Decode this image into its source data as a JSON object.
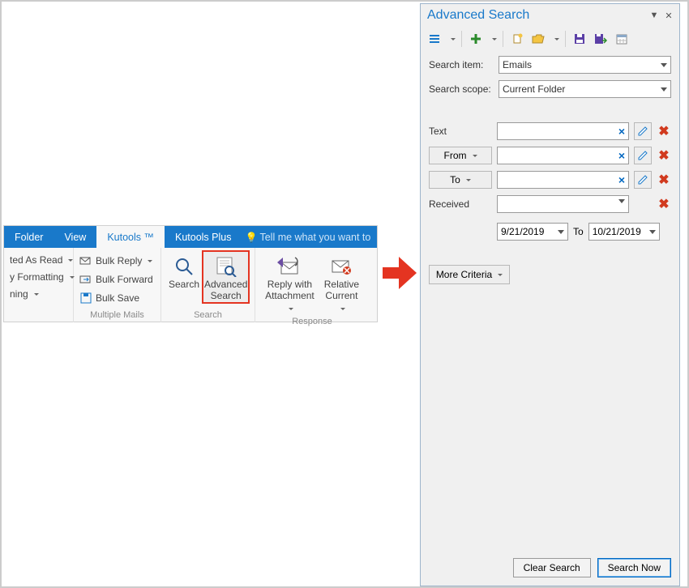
{
  "ribbon": {
    "tabs": [
      "Folder",
      "View",
      "Kutools ™",
      "Kutools Plus"
    ],
    "active_tab": 2,
    "tell_me": "Tell me what you want to",
    "groups": {
      "col0": {
        "items": [
          "ted As Read",
          "y Formatting",
          "ning"
        ]
      },
      "multiple_mails": {
        "title": "Multiple Mails",
        "items": [
          "Bulk Reply",
          "Bulk Forward",
          "Bulk Save"
        ]
      },
      "search": {
        "title": "Search",
        "search_label": "Search",
        "adv_label": "Advanced\nSearch"
      },
      "response": {
        "title": "Response",
        "reply_label": "Reply with\nAttachment",
        "relative_label": "Relative\nCurrent"
      }
    }
  },
  "panel": {
    "title": "Advanced Search",
    "search_item_label": "Search item:",
    "search_item_value": "Emails",
    "search_scope_label": "Search scope:",
    "search_scope_value": "Current Folder",
    "criteria": {
      "text_label": "Text",
      "from_label": "From",
      "to_label": "To",
      "received_label": "Received",
      "date_from": "9/21/2019",
      "date_to_label": "To",
      "date_to": "10/21/2019"
    },
    "more_criteria": "More Criteria",
    "footer": {
      "clear": "Clear Search",
      "search_now": "Search Now"
    }
  }
}
